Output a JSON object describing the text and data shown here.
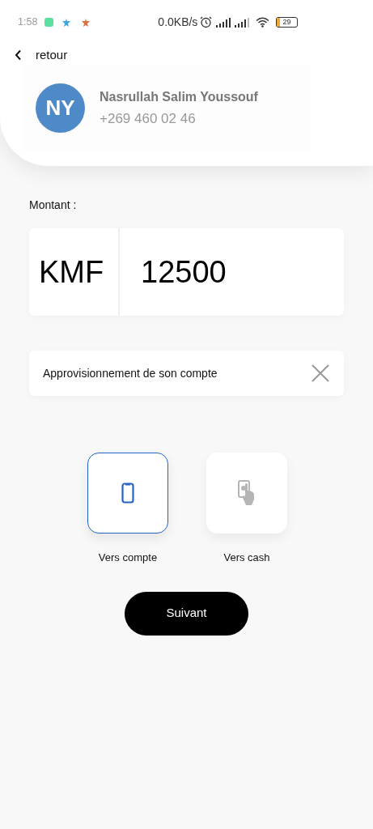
{
  "status_bar": {
    "time": "1:58",
    "speed": "0.0KB/s",
    "battery": "29"
  },
  "header": {
    "back_label": "retour"
  },
  "contact": {
    "initials": "NY",
    "name": "Nasrullah Salim Youssouf",
    "phone": "+269 460 02 46"
  },
  "amount": {
    "label": "Montant :",
    "currency": "KMF",
    "value": "12500"
  },
  "note": {
    "value": "Approvisionnement de son compte"
  },
  "options": [
    {
      "kind": "phone",
      "label": "Vers compte",
      "selected": true
    },
    {
      "kind": "cash",
      "label": "Vers cash",
      "selected": false
    }
  ],
  "next_button": "Suivant"
}
